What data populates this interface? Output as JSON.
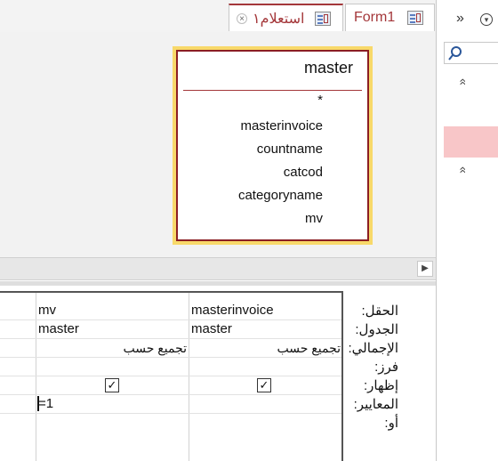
{
  "tabs": [
    {
      "label": "Form1",
      "icon": "form-icon",
      "active": false
    },
    {
      "label": "استعلام١",
      "icon": "query-icon",
      "active": true,
      "close": "×"
    }
  ],
  "field_list": {
    "table_name": "master",
    "fields": [
      "*",
      "masterinvoice",
      "countname",
      "catcod",
      "categoryname",
      "mv"
    ]
  },
  "grid": {
    "row_labels": [
      "الحقل:",
      "الجدول:",
      "الإجمالي:",
      "فرز:",
      "إظهار:",
      "المعايير:",
      "أو:"
    ],
    "columns": [
      {
        "field": "masterinvoice",
        "table": "master",
        "total": "تجميع حسب",
        "sort": "",
        "show": true,
        "criteria": ""
      },
      {
        "field": "mv",
        "table": "master",
        "total": "تجميع حسب",
        "sort": "",
        "show": true,
        "criteria": "=1"
      }
    ]
  },
  "nav": {
    "collapse_label": "»",
    "menu_icon": "chevron-down-icon",
    "search_icon": "search-icon",
    "group_chevron": "»",
    "highlight_color": "#f8c6c8"
  },
  "scroll": {
    "arrow": "▶"
  },
  "colors": {
    "accent": "#a4373a",
    "fieldlist_border": "#8b1e23",
    "fieldlist_frame": "#f8d96a"
  }
}
